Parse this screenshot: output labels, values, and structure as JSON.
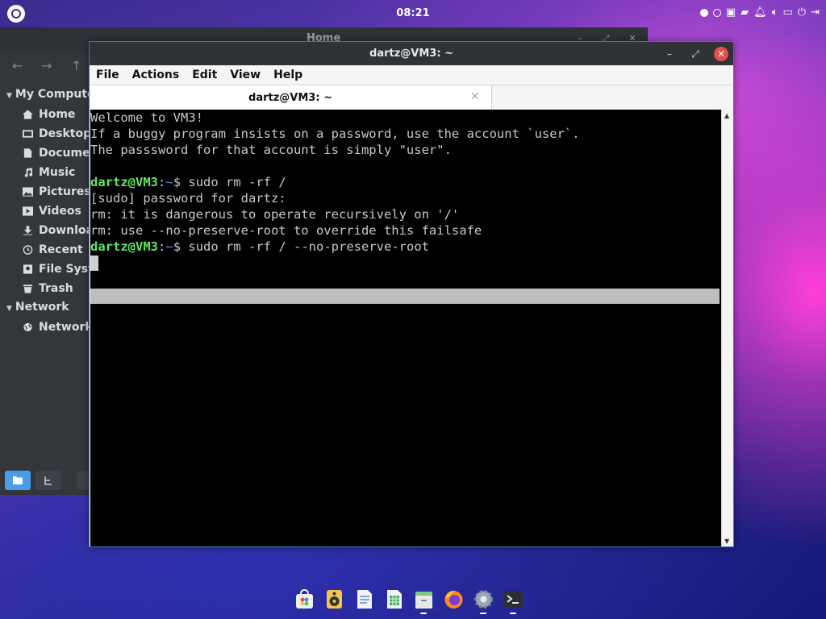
{
  "topbar": {
    "clock": "08:21",
    "logo_icon": "launcher-logo-icon",
    "status_icons": [
      "radio-full-icon",
      "radio-empty-icon",
      "window-icon",
      "folder-icon",
      "bell-icon",
      "speaker-icon",
      "display-icon",
      "power-icon",
      "logout-icon"
    ]
  },
  "file_manager": {
    "title": "Home",
    "sidebar": {
      "my_computer_label": "My Compute",
      "items": [
        {
          "label": "Home",
          "icon": "home-icon"
        },
        {
          "label": "Desktop",
          "icon": "desktop-icon"
        },
        {
          "label": "Documen",
          "icon": "document-icon"
        },
        {
          "label": "Music",
          "icon": "music-icon"
        },
        {
          "label": "Pictures",
          "icon": "pictures-icon"
        },
        {
          "label": "Videos",
          "icon": "videos-icon"
        },
        {
          "label": "Downloa",
          "icon": "download-icon"
        },
        {
          "label": "Recent",
          "icon": "recent-icon"
        },
        {
          "label": "File Syste",
          "icon": "drive-icon"
        },
        {
          "label": "Trash",
          "icon": "trash-icon"
        }
      ],
      "network_label": "Network",
      "network_items": [
        {
          "label": "Network",
          "icon": "globe-icon"
        }
      ]
    }
  },
  "terminal": {
    "title": "dartz@VM3: ~",
    "menu": [
      "File",
      "Actions",
      "Edit",
      "View",
      "Help"
    ],
    "tab_label": "dartz@VM3: ~",
    "lines": [
      "Welcome to VM3!",
      "If a buggy program insists on a password, use the account `user`.",
      "The passsword for that account is simply \"user\".",
      "",
      "",
      "[sudo] password for dartz:",
      "rm: it is dangerous to operate recursively on '/'",
      "rm: use --no-preserve-root to override this failsafe",
      ""
    ],
    "prompt_user": "dartz@VM3",
    "prompt_sep": ":",
    "prompt_path": "~",
    "prompt_dollar": "$ ",
    "cmd1": "sudo rm -rf /",
    "cmd2": "sudo rm -rf / --no-preserve-root"
  },
  "dock": {
    "icons": [
      "software-store-icon",
      "rhythmbox-icon",
      "text-editor-icon",
      "spreadsheet-icon",
      "files-icon",
      "firefox-icon",
      "settings-icon",
      "terminal-icon"
    ]
  },
  "colors": {
    "prompt_user": "#5fe85f",
    "prompt_path": "#5f8ff0",
    "close_button": "#e04e4e"
  }
}
